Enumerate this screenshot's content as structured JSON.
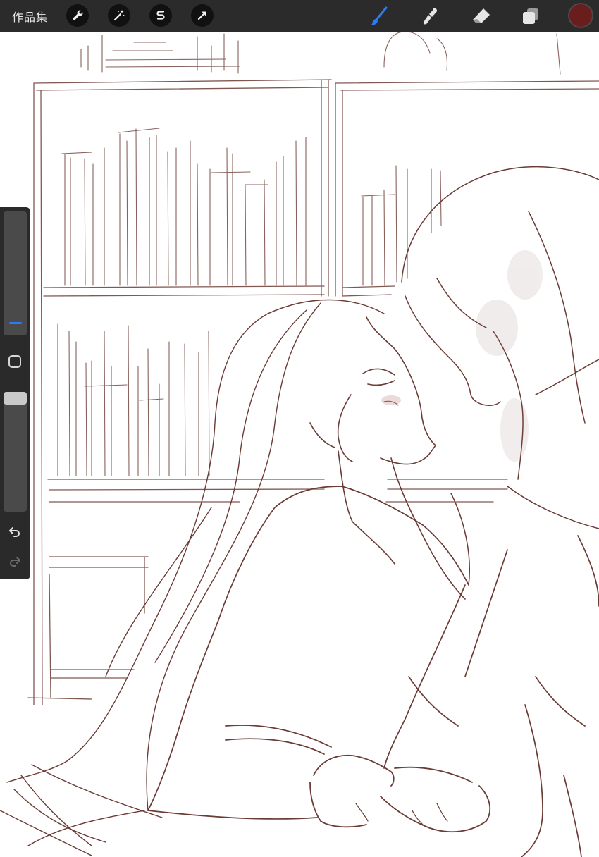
{
  "toolbar": {
    "gallery_label": "作品集",
    "actions_icon": "wrench-icon",
    "adjustments_icon": "magic-wand-icon",
    "selection_icon": "selection-icon",
    "transform_icon": "transform-arrow-icon",
    "tools": [
      {
        "name": "brush-icon",
        "active": true
      },
      {
        "name": "smudge-icon",
        "active": false
      },
      {
        "name": "eraser-icon",
        "active": false
      },
      {
        "name": "layers-icon",
        "active": false
      }
    ],
    "current_color": "#6a1d1d"
  },
  "sidebar": {
    "brush_size": 0.25,
    "opacity": 1.0,
    "undo_icon": "undo-icon",
    "redo_icon": "redo-icon",
    "modify_icon": "square-icon"
  },
  "colors": {
    "toolbar_bg": "#2b2b2b",
    "accent_blue": "#2d7bf4",
    "sketch_line": "#6b3b35"
  }
}
